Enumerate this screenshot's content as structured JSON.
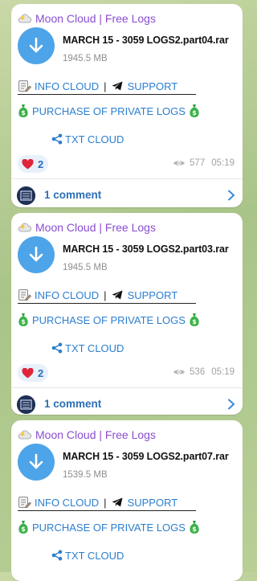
{
  "posts": [
    {
      "sender": "Moon Cloud | Free Logs",
      "file_name": "MARCH 15 - 3059 LOGS2.part04.rar",
      "file_size": "1945.5 MB",
      "link_info": "INFO CLOUD",
      "link_support": "SUPPORT",
      "separator": "|",
      "link_purchase": "PURCHASE OF PRIVATE LOGS",
      "link_txt": "TXT CLOUD",
      "reaction_count": "2",
      "views": "577",
      "time": "05:19",
      "comments": "1 comment"
    },
    {
      "sender": "Moon Cloud | Free Logs",
      "file_name": "MARCH 15 - 3059 LOGS2.part03.rar",
      "file_size": "1945.5 MB",
      "link_info": "INFO CLOUD",
      "link_support": "SUPPORT",
      "separator": "|",
      "link_purchase": "PURCHASE OF PRIVATE LOGS",
      "link_txt": "TXT CLOUD",
      "reaction_count": "2",
      "views": "536",
      "time": "05:19",
      "comments": "1 comment"
    },
    {
      "sender": "Moon Cloud | Free Logs",
      "file_name": "MARCH 15 - 3059 LOGS2.part07.rar",
      "file_size": "1539.5 MB",
      "link_info": "INFO CLOUD",
      "link_support": "SUPPORT",
      "separator": "|",
      "link_purchase": "PURCHASE OF PRIVATE LOGS",
      "link_txt": "TXT CLOUD"
    }
  ],
  "colors": {
    "sender": "#8a4ed1",
    "link": "#2b7fd0",
    "file_button": "#4ea4e8",
    "background": "#b4cc92"
  }
}
